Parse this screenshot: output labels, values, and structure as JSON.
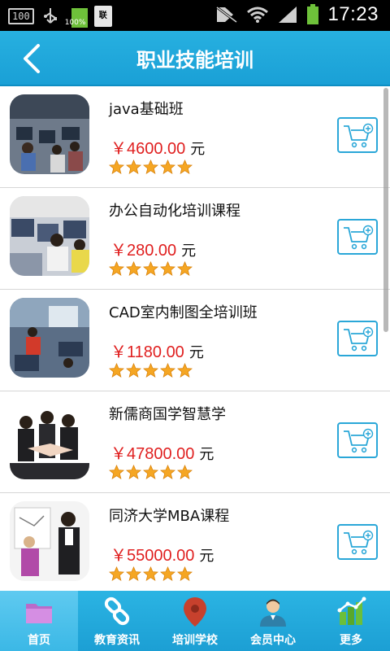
{
  "status_bar": {
    "signal_box": "100",
    "battery_small_pct": "100%",
    "doc_label": "联",
    "time": "17:23"
  },
  "header": {
    "title": "职业技能培训"
  },
  "courses": [
    {
      "name": "java基础班",
      "price": "￥4600.00",
      "unit": "元",
      "rating": 5
    },
    {
      "name": "办公自动化培训课程",
      "price": "￥280.00",
      "unit": "元",
      "rating": 5
    },
    {
      "name": "CAD室内制图全培训班",
      "price": "￥1180.00",
      "unit": "元",
      "rating": 5
    },
    {
      "name": "新儒商国学智慧学",
      "price": "￥47800.00",
      "unit": "元",
      "rating": 5
    },
    {
      "name": "同济大学MBA课程",
      "price": "￥55000.00",
      "unit": "元",
      "rating": 5
    }
  ],
  "bottom_nav": {
    "items": [
      {
        "label": "首页",
        "icon": "folder-icon",
        "active": true
      },
      {
        "label": "教育资讯",
        "icon": "link-icon",
        "active": false
      },
      {
        "label": "培训学校",
        "icon": "map-pin-icon",
        "active": false
      },
      {
        "label": "会员中心",
        "icon": "user-icon",
        "active": false
      },
      {
        "label": "更多",
        "icon": "chart-icon",
        "active": false
      }
    ]
  },
  "colors": {
    "brand_blue": "#1aa0d6",
    "price_red": "#e02020",
    "star_orange": "#f5a623"
  }
}
